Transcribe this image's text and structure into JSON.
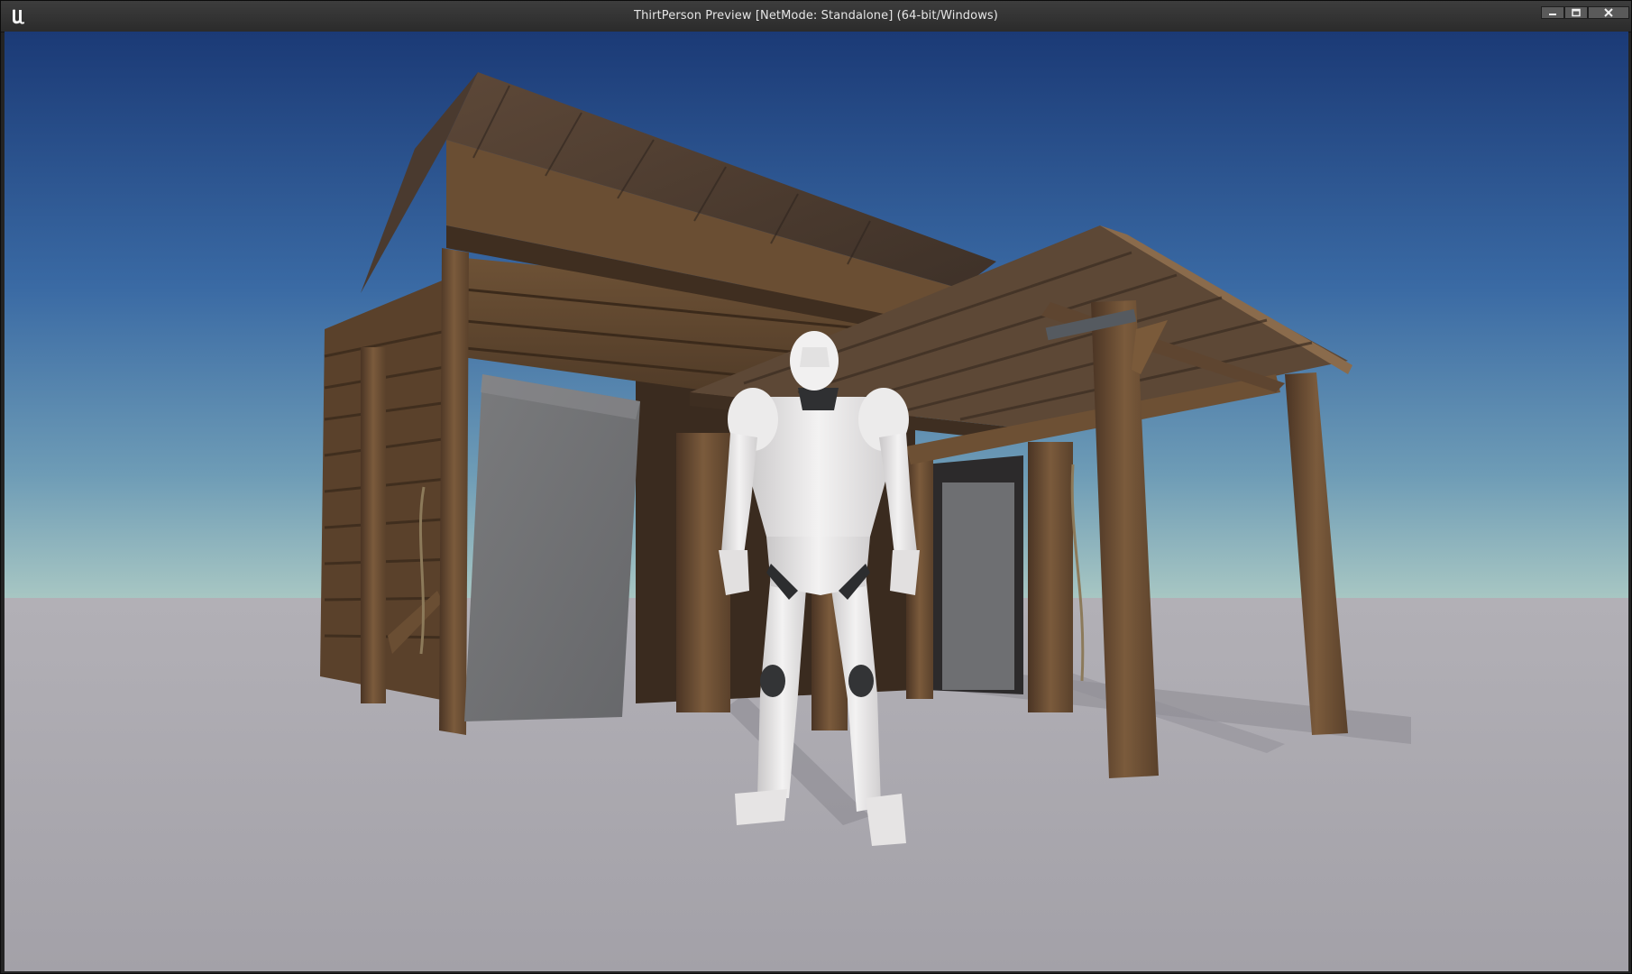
{
  "window": {
    "title": "ThirtPerson Preview [NetMode: Standalone]  (64-bit/Windows)"
  },
  "titlebar_buttons": {
    "minimize": "minimize-icon",
    "maximize": "maximize-icon",
    "close": "close-icon"
  },
  "icons": {
    "app_logo": "unreal-engine-logo"
  },
  "colors": {
    "sky_top": "#1d3f7c",
    "sky_mid": "#3d6ea8",
    "sky_horizon": "#9cc2c2",
    "ground": "#a9a7ad",
    "wood_dark": "#4a3522",
    "wood_light": "#7a5a3a",
    "mannequin": "#e8e6e6"
  }
}
